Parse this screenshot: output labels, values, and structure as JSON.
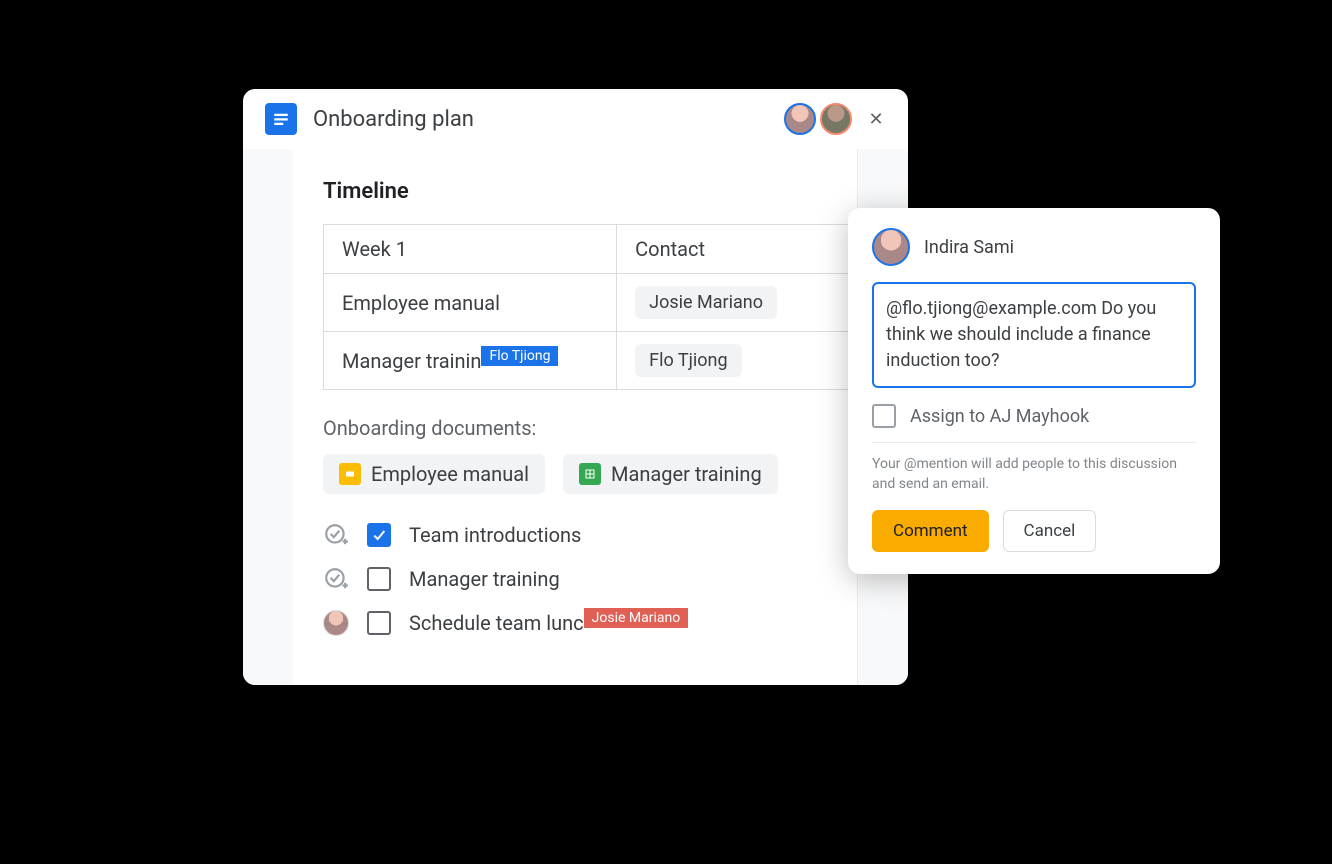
{
  "doc": {
    "title": "Onboarding plan",
    "collaborators": [
      "Indira Sami",
      "AJ Mayhook"
    ]
  },
  "timeline": {
    "heading": "Timeline",
    "col1_header": "Week 1",
    "col2_header": "Contact",
    "rows": [
      {
        "item": "Employee manual",
        "contact": "Josie Mariano"
      },
      {
        "item": "Manager trainin",
        "contact": "Flo Tjiong",
        "editing_user": "Flo Tjiong"
      }
    ]
  },
  "documents": {
    "heading": "Onboarding documents:",
    "items": [
      {
        "name": "Employee manual",
        "app": "slides"
      },
      {
        "name": "Manager training",
        "app": "sheets"
      }
    ]
  },
  "checklist": {
    "items": [
      {
        "label": "Team introductions",
        "checked": true,
        "assigned": false
      },
      {
        "label": "Manager training",
        "checked": false,
        "assigned": false
      },
      {
        "label": "Schedule team lunc",
        "checked": false,
        "assigned": true,
        "editing_user": "Josie Mariano"
      }
    ]
  },
  "comment": {
    "author": "Indira Sami",
    "text": "@flo.tjiong@example.com Do you think we should include a finance induction too?",
    "assign_label": "Assign to AJ Mayhook",
    "hint": "Your @mention will add people to this discussion and send an email.",
    "submit": "Comment",
    "cancel": "Cancel"
  }
}
